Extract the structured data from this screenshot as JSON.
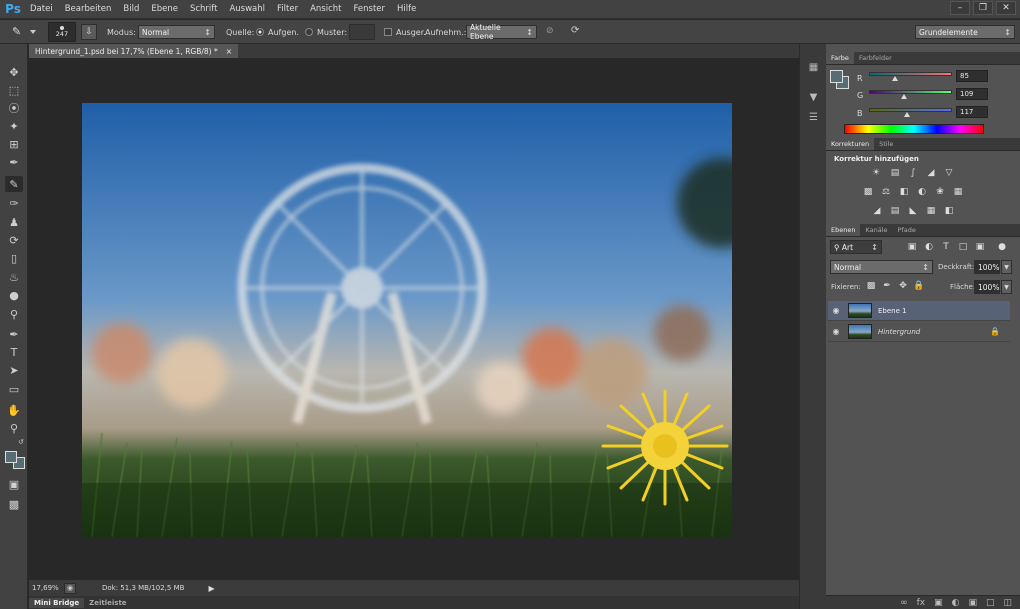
{
  "app": {
    "logo": "Ps"
  },
  "menubar": {
    "items": [
      "Datei",
      "Bearbeiten",
      "Bild",
      "Ebene",
      "Schrift",
      "Auswahl",
      "Filter",
      "Ansicht",
      "Fenster",
      "Hilfe"
    ],
    "window_buttons": [
      "–",
      "❐",
      "✕"
    ]
  },
  "options": {
    "brush_size": "247",
    "modus_label": "Modus:",
    "modus_value": "Normal",
    "quelle_label": "Quelle:",
    "aufgen_label": "Aufgen.",
    "muster_label": "Muster:",
    "ausger_label": "Ausger.",
    "aufnehm_label": "Aufnehm.:",
    "aufnehm_value": "Aktuelle Ebene",
    "workspace_value": "Grundelemente"
  },
  "document": {
    "tab_title": "Hintergrund_1.psd bei 17,7% (Ebene 1, RGB/8) *",
    "tab_close": "×",
    "zoom": "17,69%",
    "doc_info": "Dok: 51,3 MB/102,5 MB"
  },
  "bottom_tabs": [
    "Mini Bridge",
    "Zeitleiste"
  ],
  "color_panel": {
    "tabs": [
      "Farbe",
      "Farbfelder"
    ],
    "channels": [
      {
        "label": "R",
        "value": "85"
      },
      {
        "label": "G",
        "value": "109"
      },
      {
        "label": "B",
        "value": "117"
      }
    ],
    "colors": {
      "current": "#556d75",
      "accent_fg": "#556d75"
    }
  },
  "adjust_panel": {
    "tabs": [
      "Korrekturen",
      "Stile"
    ],
    "heading": "Korrektur hinzufügen"
  },
  "layers_panel": {
    "tabs": [
      "Ebenen",
      "Kanäle",
      "Pfade"
    ],
    "filter_value": "Art",
    "blend_value": "Normal",
    "opacity_label": "Deckkraft:",
    "opacity_value": "100%",
    "lock_label": "Fixieren:",
    "fill_label": "Fläche:",
    "fill_value": "100%",
    "layers": [
      {
        "name": "Ebene 1",
        "selected": true
      },
      {
        "name": "Hintergrund",
        "selected": false
      }
    ]
  }
}
